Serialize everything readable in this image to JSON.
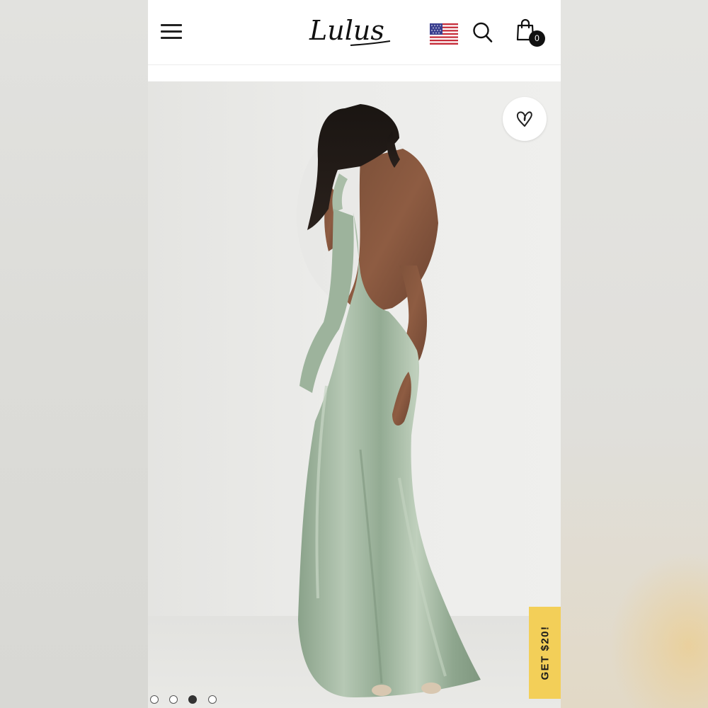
{
  "header": {
    "logo_text": "Lulus",
    "cart_count": "0",
    "icons": {
      "menu": "hamburger-menu-icon",
      "flag": "us-flag-icon",
      "search": "search-icon",
      "cart": "shopping-bag-icon"
    }
  },
  "product_image": {
    "favorite_icon": "heart-icon",
    "promo_label": "GET $20!",
    "carousel": {
      "total": 4,
      "active_index": 2
    }
  },
  "colors": {
    "promo_yellow": "#f3cf58",
    "dress_sage": "#9db39c",
    "background_gray": "#ebebe8"
  }
}
